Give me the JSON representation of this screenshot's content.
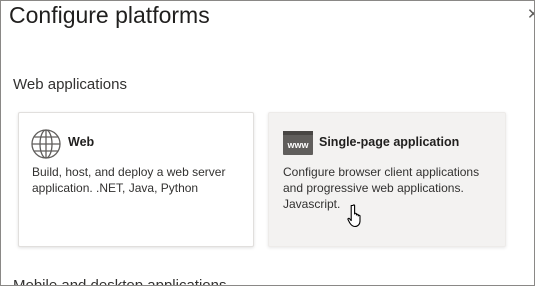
{
  "panel": {
    "title": "Configure platforms",
    "close_icon": "close-icon"
  },
  "sections": {
    "web_applications": "Web applications",
    "mobile_desktop": "Mobile and desktop applications"
  },
  "cards": {
    "web": {
      "icon": "globe-icon",
      "title": "Web",
      "description": "Build, host, and deploy a web server application. .NET, Java, Python"
    },
    "spa": {
      "icon": "www-browser-icon",
      "icon_text": "www",
      "title": "Single-page application",
      "description": "Configure browser client applications and progressive web applications. Javascript."
    }
  },
  "colors": {
    "selected_card_bg": "#f3f2f1",
    "card_bg": "#ffffff",
    "text": "#201f1e"
  }
}
